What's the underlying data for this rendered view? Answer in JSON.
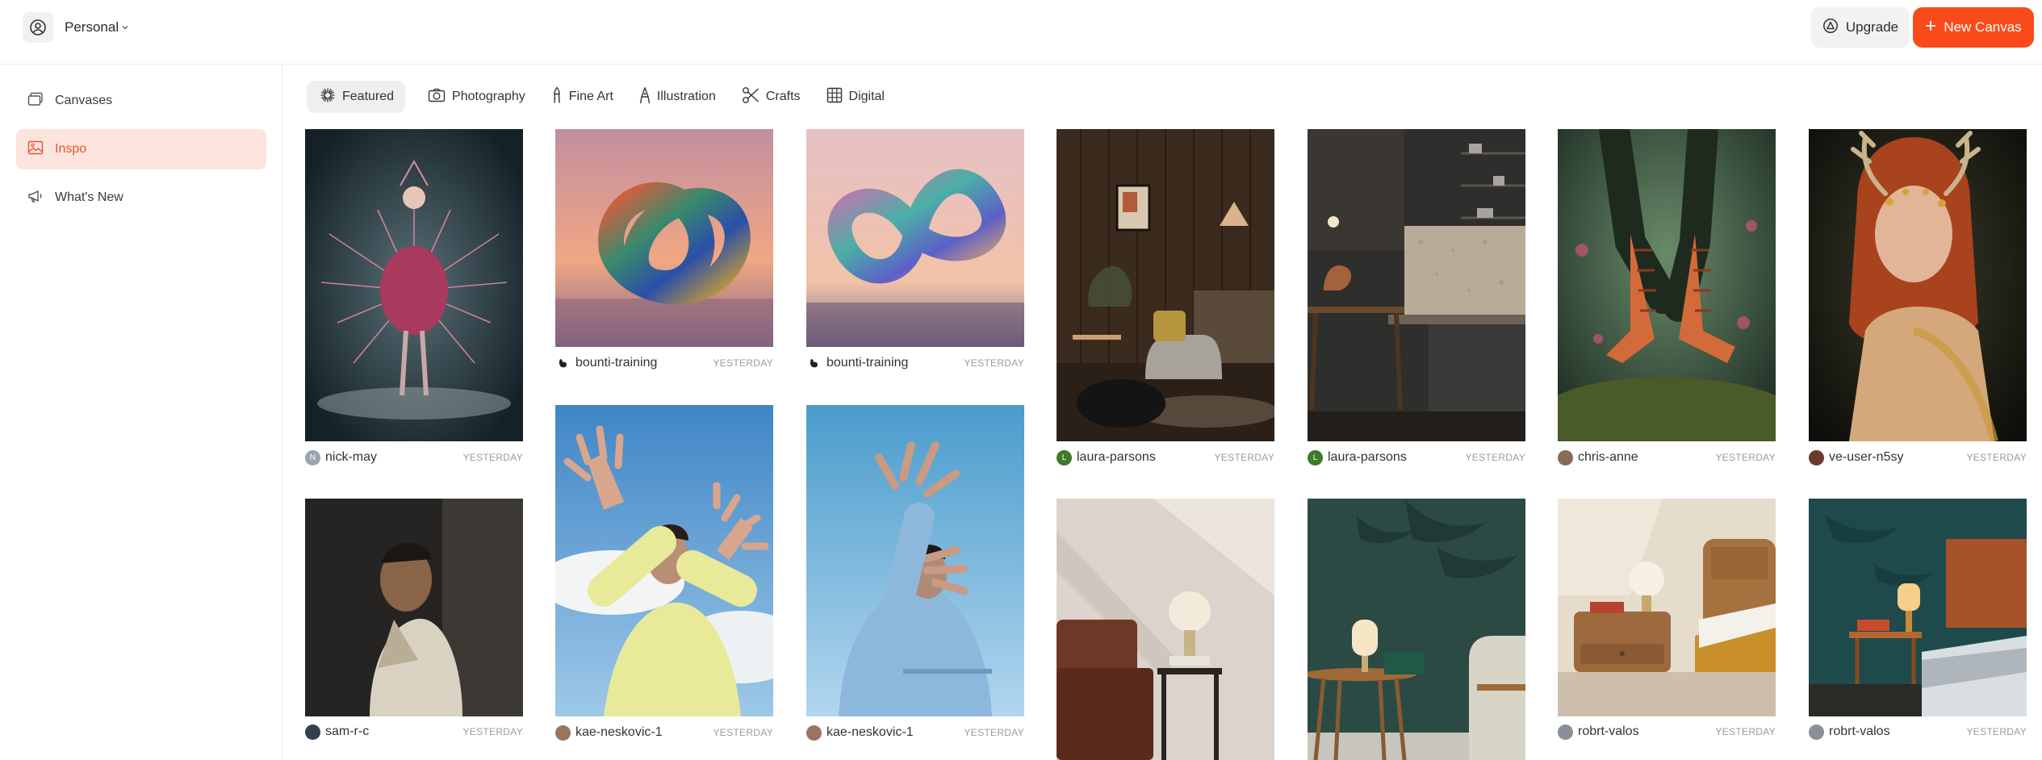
{
  "account": {
    "name": "Personal",
    "icon": "user-circle-icon"
  },
  "header": {
    "upgrade_label": "Upgrade",
    "new_canvas_label": "New Canvas",
    "accent": "#fa4a1a"
  },
  "sidebar": {
    "items": [
      {
        "label": "Canvases",
        "icon": "canvases-icon",
        "active": false
      },
      {
        "label": "Inspo",
        "icon": "image-icon",
        "active": true
      },
      {
        "label": "What's New",
        "icon": "megaphone-icon",
        "active": false
      }
    ]
  },
  "tabs": [
    {
      "label": "Featured",
      "icon": "sparkle-icon",
      "active": true
    },
    {
      "label": "Photography",
      "icon": "camera-icon",
      "active": false
    },
    {
      "label": "Fine Art",
      "icon": "brush-icon",
      "active": false
    },
    {
      "label": "Illustration",
      "icon": "pen-nib-icon",
      "active": false
    },
    {
      "label": "Crafts",
      "icon": "scissors-icon",
      "active": false
    },
    {
      "label": "Digital",
      "icon": "grid-icon",
      "active": false
    }
  ],
  "gallery": [
    {
      "user": "nick-may",
      "when": "YESTERDAY",
      "avatar_letter": "N",
      "avatar_color": "#9aa5ad",
      "subject": "fashion-spikes-portrait"
    },
    {
      "user": "sam-r-c",
      "when": "YESTERDAY",
      "avatar_letter": "",
      "avatar_color": "#32404e",
      "subject": "man-portrait-dark"
    },
    {
      "user": "bounti-training",
      "when": "YESTERDAY",
      "avatar_letter": "",
      "avatar_color": "#222222",
      "subject": "iridescent-knot-sunset"
    },
    {
      "user": "kae-neskovic-1",
      "when": "YESTERDAY",
      "avatar_letter": "",
      "avatar_color": "#9a7460",
      "subject": "woman-yellow-hands-sky"
    },
    {
      "user": "bounti-training",
      "when": "YESTERDAY",
      "avatar_letter": "",
      "avatar_color": "#222222",
      "subject": "iridescent-knot-pink"
    },
    {
      "user": "kae-neskovic-1",
      "when": "YESTERDAY",
      "avatar_letter": "",
      "avatar_color": "#9a7460",
      "subject": "woman-blue-hands-sky"
    },
    {
      "user": "laura-parsons",
      "when": "YESTERDAY",
      "avatar_letter": "L",
      "avatar_color": "#3d7a2c",
      "subject": "wood-living-room"
    },
    {
      "user": "",
      "when": "",
      "avatar_letter": "",
      "avatar_color": "",
      "subject": "leather-sofa-lamp"
    },
    {
      "user": "laura-parsons",
      "when": "YESTERDAY",
      "avatar_letter": "L",
      "avatar_color": "#3d7a2c",
      "subject": "dark-kitchen"
    },
    {
      "user": "",
      "when": "",
      "avatar_letter": "",
      "avatar_color": "",
      "subject": "green-wall-side-table"
    },
    {
      "user": "chris-anne",
      "when": "YESTERDAY",
      "avatar_letter": "",
      "avatar_color": "#8a6a58",
      "subject": "orange-boots-forest"
    },
    {
      "user": "robrt-valos",
      "when": "YESTERDAY",
      "avatar_letter": "",
      "avatar_color": "#8a8f99",
      "subject": "beige-bedroom-lamp"
    },
    {
      "user": "ve-user-n5sy",
      "when": "YESTERDAY",
      "avatar_letter": "",
      "avatar_color": "#6a3a2a",
      "subject": "antler-fantasy-portrait"
    },
    {
      "user": "robrt-valos",
      "when": "YESTERDAY",
      "avatar_letter": "",
      "avatar_color": "#8a8f99",
      "subject": "teal-bedroom-lamp"
    }
  ]
}
